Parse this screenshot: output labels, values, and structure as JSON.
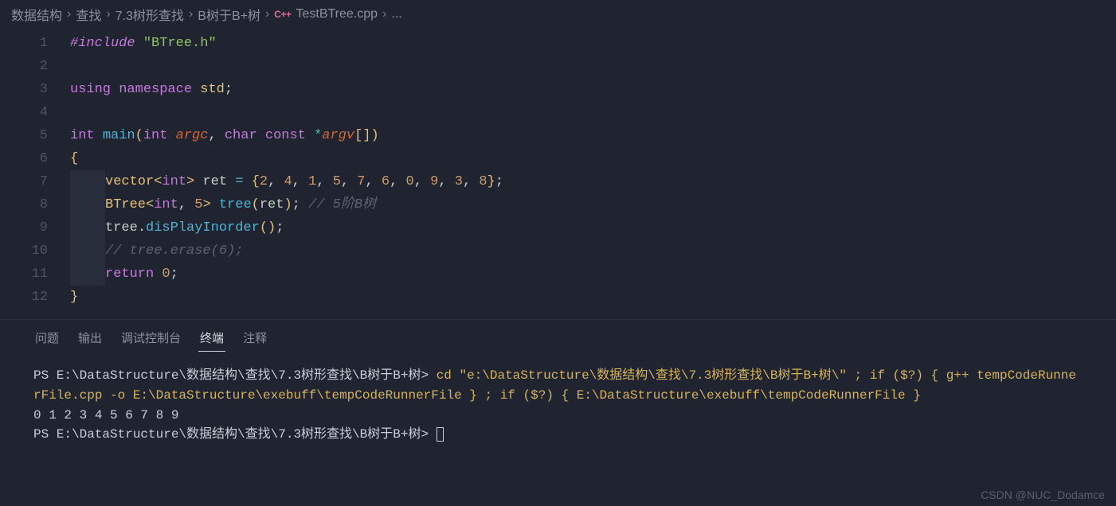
{
  "breadcrumb": {
    "items": [
      "数据结构",
      "查找",
      "7.3树形查找",
      "B树于B+树"
    ],
    "file": "TestBTree.cpp",
    "more": "..."
  },
  "code": {
    "line1": {
      "include": "#include",
      "str": "\"BTree.h\""
    },
    "line3": {
      "using": "using",
      "namespace": "namespace",
      "std": "std",
      "semi": ";"
    },
    "line5": {
      "int": "int",
      "main": "main",
      "lp": "(",
      "int2": "int",
      "argc": "argc",
      "comma": ",",
      "char": "char",
      "const": "const",
      "star": "*",
      "argv": "argv",
      "br": "[]",
      "rp": ")"
    },
    "line6": {
      "brace": "{"
    },
    "line7": {
      "vector": "vector",
      "lt": "<",
      "int": "int",
      "gt": ">",
      "ret": "ret",
      "eq": "=",
      "lb": "{",
      "n0": "2",
      "n1": "4",
      "n2": "1",
      "n3": "5",
      "n4": "7",
      "n5": "6",
      "n6": "0",
      "n7": "9",
      "n8": "3",
      "n9": "8",
      "rb": "}",
      "semi": ";",
      "c1": ",",
      "c2": ",",
      "c3": ",",
      "c4": ",",
      "c5": ",",
      "c6": ",",
      "c7": ",",
      "c8": ",",
      "c9": ","
    },
    "line8": {
      "btree": "BTree",
      "lt": "<",
      "int": "int",
      "comma": ",",
      "five": "5",
      "gt": ">",
      "tree": "tree",
      "lp": "(",
      "ret": "ret",
      "rp": ")",
      "semi": ";",
      "cmt": "// 5阶B树"
    },
    "line9": {
      "tree": "tree",
      "dot": ".",
      "call": "disPlayInorder",
      "lp": "(",
      "rp": ")",
      "semi": ";"
    },
    "line10": {
      "cmt": "// tree.erase(6);"
    },
    "line11": {
      "return": "return",
      "zero": "0",
      "semi": ";"
    },
    "line12": {
      "brace": "}"
    }
  },
  "tabs": {
    "t0": "问题",
    "t1": "输出",
    "t2": "调试控制台",
    "t3": "终端",
    "t4": "注释"
  },
  "terminal": {
    "prompt1": "PS E:\\DataStructure\\数据结构\\查找\\7.3树形查找\\B树于B+树>",
    "cmd1a": " cd ",
    "cmd1b": "\"e:\\DataStructure\\数据结构\\查找\\7.3树形查找\\B树于B+树\\\"",
    "cmd1c": " ; if (",
    "cmd2a": "$?",
    "cmd2b": ") { g++ tempCodeRunnerFile.cpp -o E:\\DataStructure\\exebuff\\tempCodeRunnerFile } ",
    "cmd2c": "; if (",
    "cmd2d": "$?",
    "cmd2e": ") { E:\\DataStructure\\exebuff\\tempCodeRunnerFile }",
    "output": "0 1 2 3 4 5 6 7 8 9",
    "prompt2": "PS E:\\DataStructure\\数据结构\\查找\\7.3树形查找\\B树于B+树>"
  },
  "watermark": "CSDN @NUC_Dodamce"
}
